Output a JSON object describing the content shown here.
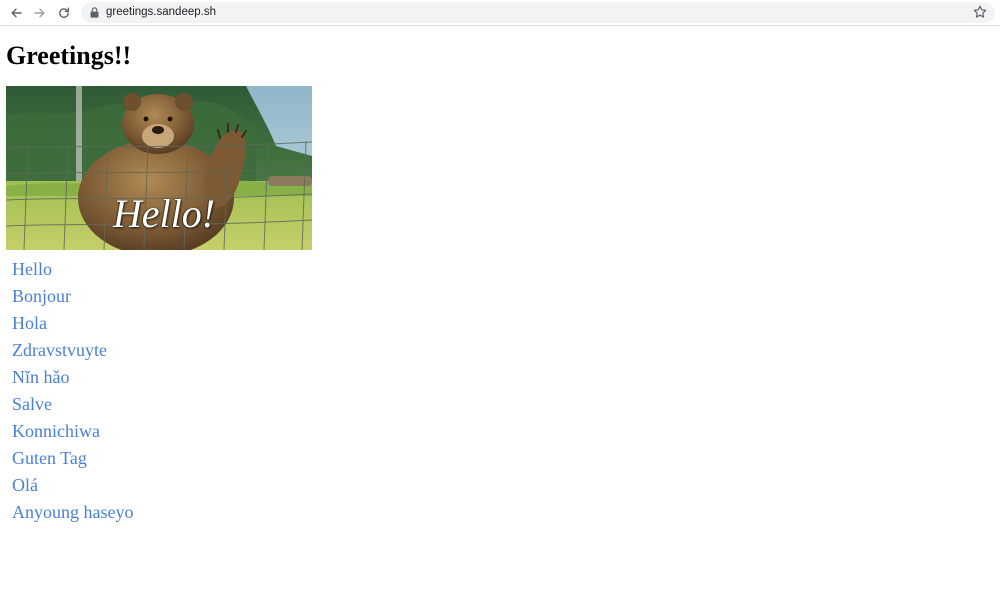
{
  "browser": {
    "url": "greetings.sandeep.sh",
    "icons": {
      "back": "arrow-left-icon",
      "forward": "arrow-right-icon",
      "reload": "reload-icon",
      "lock": "lock-icon",
      "bookmark": "star-icon"
    }
  },
  "page": {
    "title": "Greetings!!",
    "hero": {
      "caption": "Hello!"
    },
    "greetings": [
      "Hello",
      "Bonjour",
      "Hola",
      "Zdravstvuyte",
      "Nǐn hǎo",
      "Salve",
      "Konnichiwa",
      "Guten Tag",
      "Olá",
      "Anyoung haseyo"
    ]
  },
  "colors": {
    "link": "#4a7fd6",
    "omnibox": "#f1f3f4",
    "title": "#000000"
  }
}
